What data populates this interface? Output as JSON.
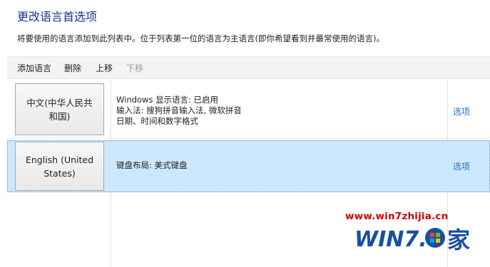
{
  "page": {
    "title": "更改语言首选项",
    "description": "将要使用的语言添加到此列表中。位于列表第一位的语言为主语言(即你希望看到并最常使用的语言)。"
  },
  "toolbar": {
    "add": "添加语言",
    "remove": "删除",
    "up": "上移",
    "down": "下移"
  },
  "languages": [
    {
      "name": "中文(中华人民共和国)",
      "details": [
        "Windows 显示语言: 已启用",
        "输入法: 搜狗拼音输入法, 微软拼音",
        "日期、时间和数字格式"
      ],
      "options": "选项"
    },
    {
      "name": "English (United States)",
      "details": [
        "键盘布局: 美式键盘"
      ],
      "options": "选项"
    }
  ],
  "watermark": {
    "url": "www.win7zhijia.cn",
    "logo_text": "WIN7.",
    "logo_char": "家"
  },
  "colors": {
    "selected_row": "#cce8ff",
    "link": "#1f6fb5",
    "title": "#1e3287",
    "watermark_red": "#d40000",
    "watermark_blue": "#1a4fa0"
  }
}
